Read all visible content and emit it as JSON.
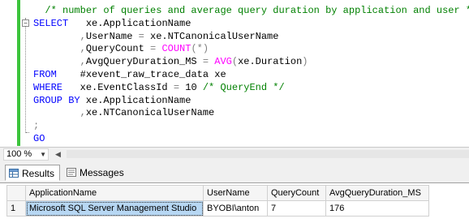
{
  "editor": {
    "lines": [
      [
        {
          "t": "  ",
          "c": ""
        },
        {
          "t": "/* number of queries and average query duration by application and user */",
          "c": "cm"
        }
      ],
      [
        {
          "t": "SELECT",
          "c": "kw"
        },
        {
          "t": "   xe.ApplicationName",
          "c": ""
        }
      ],
      [
        {
          "t": "        ",
          "c": ""
        },
        {
          "t": ",",
          "c": "op"
        },
        {
          "t": "UserName ",
          "c": ""
        },
        {
          "t": "=",
          "c": "op"
        },
        {
          "t": " xe.NTCanonicalUserName",
          "c": ""
        }
      ],
      [
        {
          "t": "        ",
          "c": ""
        },
        {
          "t": ",",
          "c": "op"
        },
        {
          "t": "QueryCount ",
          "c": ""
        },
        {
          "t": "=",
          "c": "op"
        },
        {
          "t": " ",
          "c": ""
        },
        {
          "t": "COUNT",
          "c": "fn"
        },
        {
          "t": "(*)",
          "c": "op"
        }
      ],
      [
        {
          "t": "        ",
          "c": ""
        },
        {
          "t": ",",
          "c": "op"
        },
        {
          "t": "AvgQueryDuration_MS ",
          "c": ""
        },
        {
          "t": "=",
          "c": "op"
        },
        {
          "t": " ",
          "c": ""
        },
        {
          "t": "AVG",
          "c": "fn"
        },
        {
          "t": "(",
          "c": "op"
        },
        {
          "t": "xe.Duration",
          "c": ""
        },
        {
          "t": ")",
          "c": "op"
        }
      ],
      [
        {
          "t": "FROM",
          "c": "kw"
        },
        {
          "t": "    #xevent_raw_trace_data xe",
          "c": ""
        }
      ],
      [
        {
          "t": "WHERE",
          "c": "kw"
        },
        {
          "t": "   xe.EventClassId ",
          "c": ""
        },
        {
          "t": "=",
          "c": "op"
        },
        {
          "t": " 10 ",
          "c": ""
        },
        {
          "t": "/* QueryEnd */",
          "c": "cm"
        }
      ],
      [
        {
          "t": "GROUP BY",
          "c": "kw"
        },
        {
          "t": " xe.ApplicationName",
          "c": ""
        }
      ],
      [
        {
          "t": "        ",
          "c": ""
        },
        {
          "t": ",",
          "c": "op"
        },
        {
          "t": "xe.NTCanonicalUserName",
          "c": ""
        }
      ],
      [
        {
          "t": ";",
          "c": "op"
        }
      ],
      [
        {
          "t": "GO",
          "c": "kw"
        }
      ]
    ]
  },
  "zoom": {
    "value": "100 %"
  },
  "tabs": {
    "results": "Results",
    "messages": "Messages"
  },
  "grid": {
    "columns": [
      "ApplicationName",
      "UserName",
      "QueryCount",
      "AvgQueryDuration_MS"
    ],
    "rows": [
      {
        "num": "1",
        "cells": [
          "Microsoft SQL Server Management Studio",
          "BYOBI\\anton",
          "7",
          "176"
        ]
      }
    ]
  },
  "colors": {
    "keyword": "#0000ff",
    "function": "#ff00ff",
    "comment": "#008000",
    "operator": "#808080",
    "selection": "#b7d7f3",
    "change_bar": "#3cc43c"
  }
}
